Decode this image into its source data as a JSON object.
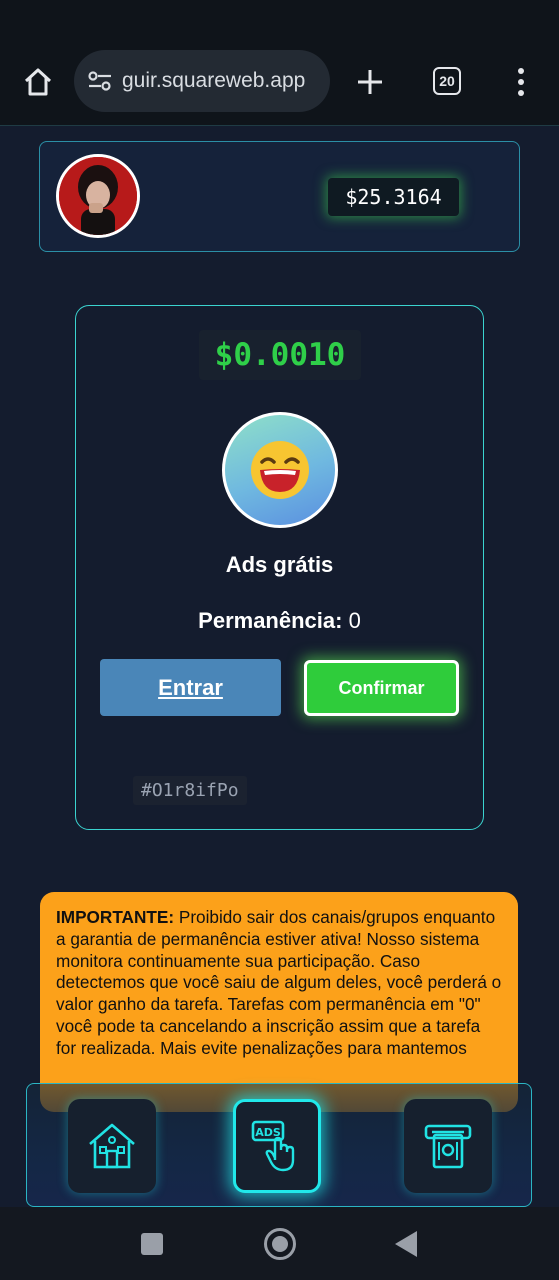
{
  "browser": {
    "url": "guir.squareweb.app",
    "tab_count": "20"
  },
  "profile": {
    "balance": "$25.3164"
  },
  "task": {
    "reward": "$0.0010",
    "title": "Ads grátis",
    "permanence_label": "Permanência:",
    "permanence_value": "0",
    "enter_label": "Entrar",
    "confirm_label": "Confirmar",
    "code": "#O1r8ifPo"
  },
  "warning": {
    "heading": "IMPORTANTE:",
    "body": "Proibido sair dos canais/grupos enquanto a garantia de permanência estiver ativa! Nosso sistema monitora continuamente sua participação. Caso detectemos que você saiu de algum deles, você perderá o valor ganho da tarefa. Tarefas com permanência em \"0\" você pode ta cancelando a inscrição assim que a tarefa for realizada. Mais evite penalizações para mantemos"
  },
  "nav": {
    "items": [
      {
        "icon": "home-icon",
        "active": false
      },
      {
        "icon": "ads-icon",
        "active": true
      },
      {
        "icon": "atm-withdraw-icon",
        "active": false
      }
    ],
    "accent_color": "#21e8ea"
  },
  "colors": {
    "background": "#141c2e",
    "card_border": "#3bd3cf",
    "reward_green": "#2fcf49",
    "enter_button": "#4a86b8",
    "confirm_button": "#2fcc3b",
    "warning_bg": "#fca11a"
  }
}
